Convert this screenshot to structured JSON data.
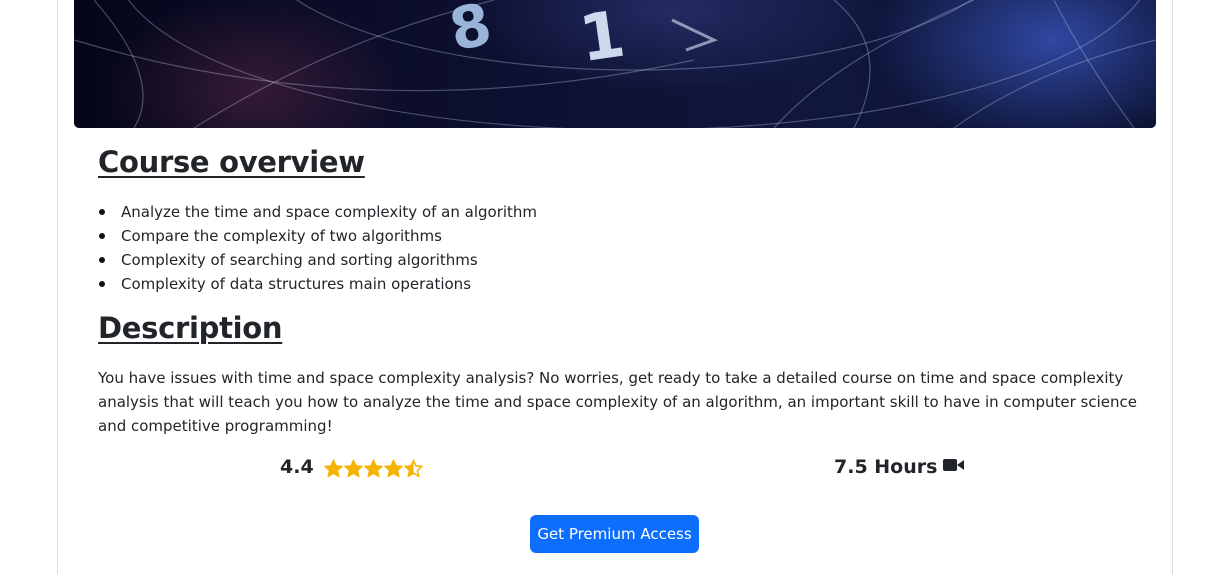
{
  "hero": {
    "digits": [
      "8",
      "1"
    ]
  },
  "overview": {
    "title": "Course overview",
    "items": [
      "Analyze the time and space complexity of an algorithm",
      "Compare the complexity of two algorithms",
      "Complexity of searching and sorting algorithms",
      "Complexity of data structures main operations"
    ]
  },
  "description": {
    "title": "Description",
    "text": "You have issues with time and space complexity analysis? No worries, get ready to take a detailed course on time and space complexity analysis that will teach you how to analyze the time and space complexity of an algorithm, an important skill to have in computer science and competitive programming!"
  },
  "stats": {
    "rating": "4.4",
    "rating_value": 4.4,
    "rating_max": 5,
    "duration": "7.5 Hours",
    "duration_icon": "video-camera-icon",
    "star_icon": "star-icon"
  },
  "cta": {
    "label": "Get Premium Access"
  },
  "colors": {
    "accent": "#0d6efd",
    "star": "#f5b301",
    "text": "#212529"
  }
}
